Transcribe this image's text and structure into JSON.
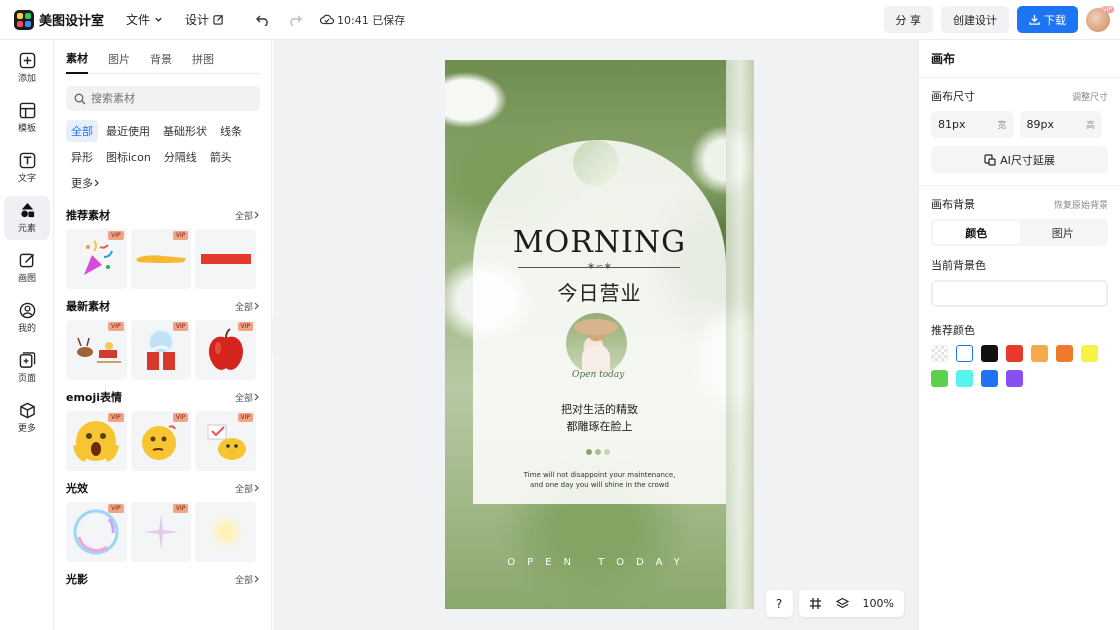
{
  "topbar": {
    "app_name": "美图设计室",
    "menu_file": "文件",
    "menu_design": "设计",
    "save_status": "10:41 已保存",
    "share_label": "分 享",
    "create_label": "创建设计",
    "download_label": "下载",
    "avatar_badge": "VIP",
    "accent": "#1d74f5"
  },
  "rail": {
    "items": [
      {
        "label": "添加",
        "icon": "plus-square-icon"
      },
      {
        "label": "模板",
        "icon": "template-icon"
      },
      {
        "label": "文字",
        "icon": "text-icon"
      },
      {
        "label": "元素",
        "icon": "shapes-icon"
      },
      {
        "label": "画图",
        "icon": "draw-icon"
      },
      {
        "label": "我的",
        "icon": "user-icon"
      },
      {
        "label": "页面",
        "icon": "page-add-icon"
      },
      {
        "label": "更多",
        "icon": "cube-icon"
      }
    ],
    "active_index": 3
  },
  "panel": {
    "tabs": [
      "素材",
      "图片",
      "背景",
      "拼图"
    ],
    "active_tab": 0,
    "search_placeholder": "搜索素材",
    "categories": [
      "全部",
      "最近使用",
      "基础形状",
      "线条",
      "异形",
      "图标icon",
      "分隔线",
      "箭头",
      "更多"
    ],
    "active_category": 0,
    "all_label": "全部",
    "vip_label": "VIP",
    "sections": [
      {
        "title": "推荐素材"
      },
      {
        "title": "最新素材"
      },
      {
        "title": "emoji表情"
      },
      {
        "title": "光效"
      },
      {
        "title": "光影"
      }
    ]
  },
  "poster": {
    "heading": "MORNING",
    "ornament": "∗∽∗",
    "cn_title": "今日营业",
    "script_text": "Open today",
    "body_line1": "把对生活的精致",
    "body_line2": "都雕琢在脸上",
    "en_line1": "Time will not disappoint your maintenance,",
    "en_line2": "and one day you will shine in the crowd",
    "footer": "OPEN TODAY"
  },
  "zoom": {
    "help_label": "?",
    "zoom_value": "100%"
  },
  "right_panel": {
    "title": "画布",
    "size_label": "画布尺寸",
    "resize_link": "调整尺寸",
    "width_value": "81px",
    "width_unit": "宽",
    "height_value": "89px",
    "height_unit": "高",
    "ai_extend_label": "AI尺寸延展",
    "bg_label": "画布背景",
    "restore_link": "恢复原始背景",
    "seg_color": "颜色",
    "seg_image": "图片",
    "current_bg_label": "当前背景色",
    "recommend_label": "推荐颜色",
    "swatches": [
      "transparent",
      "#ffffff",
      "#111111",
      "#e53a2c",
      "#f5a94a",
      "#ef7a2e",
      "#f8f148",
      "#5cd04a",
      "#5af2ef",
      "#1f74f3",
      "#8a4ff0"
    ]
  }
}
